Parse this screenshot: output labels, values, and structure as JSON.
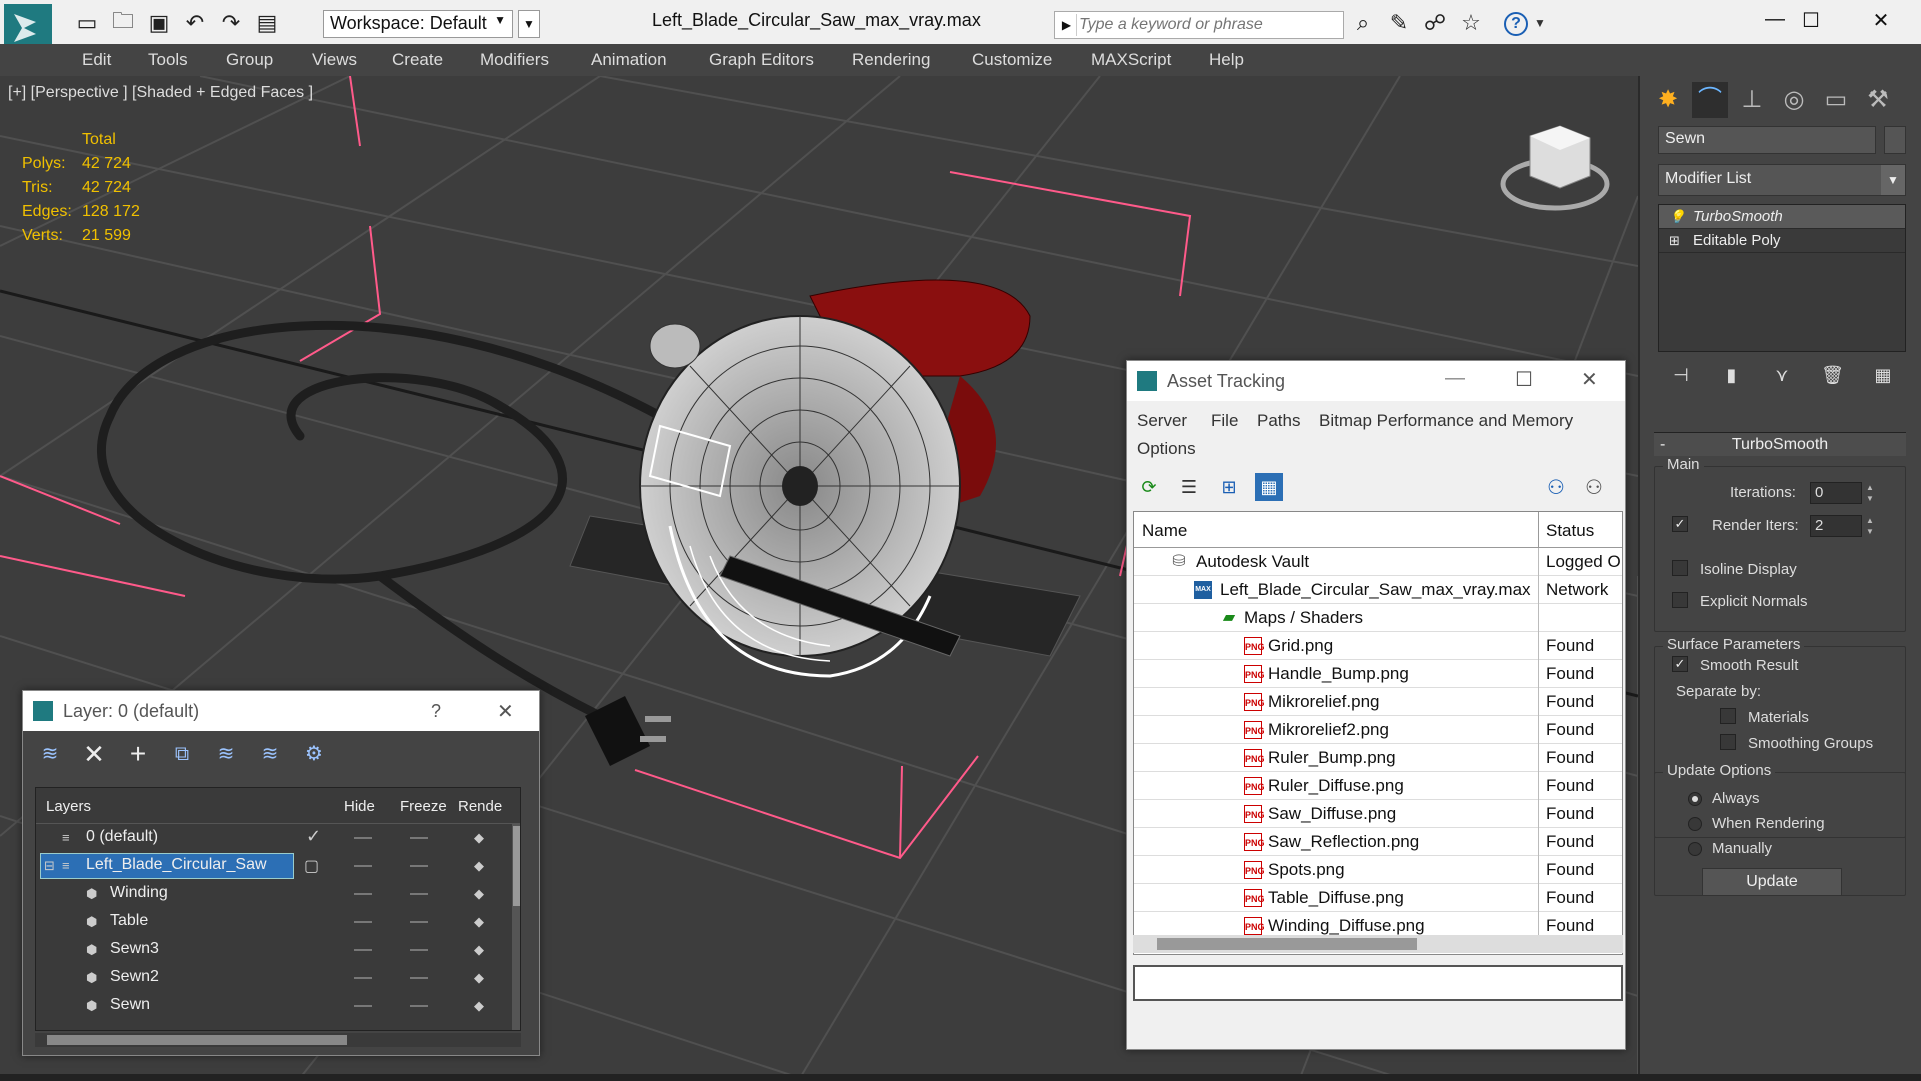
{
  "titlebar": {
    "workspace_label": "Workspace: Default",
    "document_title": "Left_Blade_Circular_Saw_max_vray.max",
    "search_placeholder": "Type a keyword or phrase",
    "help_label": "?"
  },
  "menu": [
    "Edit",
    "Tools",
    "Group",
    "Views",
    "Create",
    "Modifiers",
    "Animation",
    "Graph Editors",
    "Rendering",
    "Customize",
    "MAXScript",
    "Help"
  ],
  "viewport": {
    "label": "[+] [Perspective ] [Shaded + Edged Faces ]",
    "stats_header": "Total",
    "stats": [
      {
        "key": "Polys:",
        "value": "42 724"
      },
      {
        "key": "Tris:",
        "value": "42 724"
      },
      {
        "key": "Edges:",
        "value": "128 172"
      },
      {
        "key": "Verts:",
        "value": "21 599"
      }
    ],
    "grid_color": "#4f4f4f",
    "bound_color": "#ff5a8a"
  },
  "command_panel": {
    "object_name": "Sewn",
    "modifier_list_label": "Modifier List",
    "stack": [
      {
        "label": "TurboSmooth",
        "selected": true,
        "icon": "lightbulb-icon"
      },
      {
        "label": "Editable Poly",
        "selected": false,
        "icon": "plus-box-icon"
      }
    ],
    "rollout_title": "TurboSmooth",
    "main_group": "Main",
    "iterations_label": "Iterations:",
    "iterations_value": "0",
    "render_iters_label": "Render Iters:",
    "render_iters_value": "2",
    "isoline_label": "Isoline Display",
    "explicit_normals_label": "Explicit Normals",
    "surface_group": "Surface Parameters",
    "smooth_result_label": "Smooth Result",
    "separate_by_label": "Separate by:",
    "materials_label": "Materials",
    "smoothing_groups_label": "Smoothing Groups",
    "update_group": "Update Options",
    "always_label": "Always",
    "when_rendering_label": "When Rendering",
    "manually_label": "Manually",
    "update_button": "Update"
  },
  "layer_window": {
    "title": "Layer: 0 (default)",
    "help": "?",
    "headers": {
      "layers": "Layers",
      "hide": "Hide",
      "freeze": "Freeze",
      "render": "Rende"
    },
    "rows": [
      {
        "name": "0 (default)",
        "level": 0,
        "selected": false
      },
      {
        "name": "Left_Blade_Circular_Saw",
        "level": 0,
        "selected": true
      },
      {
        "name": "Winding",
        "level": 1,
        "selected": false
      },
      {
        "name": "Table",
        "level": 1,
        "selected": false
      },
      {
        "name": "Sewn3",
        "level": 1,
        "selected": false
      },
      {
        "name": "Sewn2",
        "level": 1,
        "selected": false
      },
      {
        "name": "Sewn",
        "level": 1,
        "selected": false
      }
    ]
  },
  "asset_window": {
    "title": "Asset Tracking",
    "menu": [
      "Server",
      "File",
      "Paths",
      "Bitmap Performance and Memory",
      "Options"
    ],
    "headers": {
      "name": "Name",
      "status": "Status"
    },
    "rows": [
      {
        "name": "Autodesk Vault",
        "status": "Logged O",
        "level": 0,
        "icon": "vault"
      },
      {
        "name": "Left_Blade_Circular_Saw_max_vray.max",
        "status": "Network",
        "level": 1,
        "icon": "max"
      },
      {
        "name": "Maps / Shaders",
        "status": "",
        "level": 2,
        "icon": "maps"
      },
      {
        "name": "Grid.png",
        "status": "Found",
        "level": 3,
        "icon": "png"
      },
      {
        "name": "Handle_Bump.png",
        "status": "Found",
        "level": 3,
        "icon": "png"
      },
      {
        "name": "Mikrorelief.png",
        "status": "Found",
        "level": 3,
        "icon": "png"
      },
      {
        "name": "Mikrorelief2.png",
        "status": "Found",
        "level": 3,
        "icon": "png"
      },
      {
        "name": "Ruler_Bump.png",
        "status": "Found",
        "level": 3,
        "icon": "png"
      },
      {
        "name": "Ruler_Diffuse.png",
        "status": "Found",
        "level": 3,
        "icon": "png"
      },
      {
        "name": "Saw_Diffuse.png",
        "status": "Found",
        "level": 3,
        "icon": "png"
      },
      {
        "name": "Saw_Reflection.png",
        "status": "Found",
        "level": 3,
        "icon": "png"
      },
      {
        "name": "Spots.png",
        "status": "Found",
        "level": 3,
        "icon": "png"
      },
      {
        "name": "Table_Diffuse.png",
        "status": "Found",
        "level": 3,
        "icon": "png"
      },
      {
        "name": "Winding_Diffuse.png",
        "status": "Found",
        "level": 3,
        "icon": "png"
      }
    ],
    "png_badge": "PNG",
    "max_badge": "MAX"
  }
}
